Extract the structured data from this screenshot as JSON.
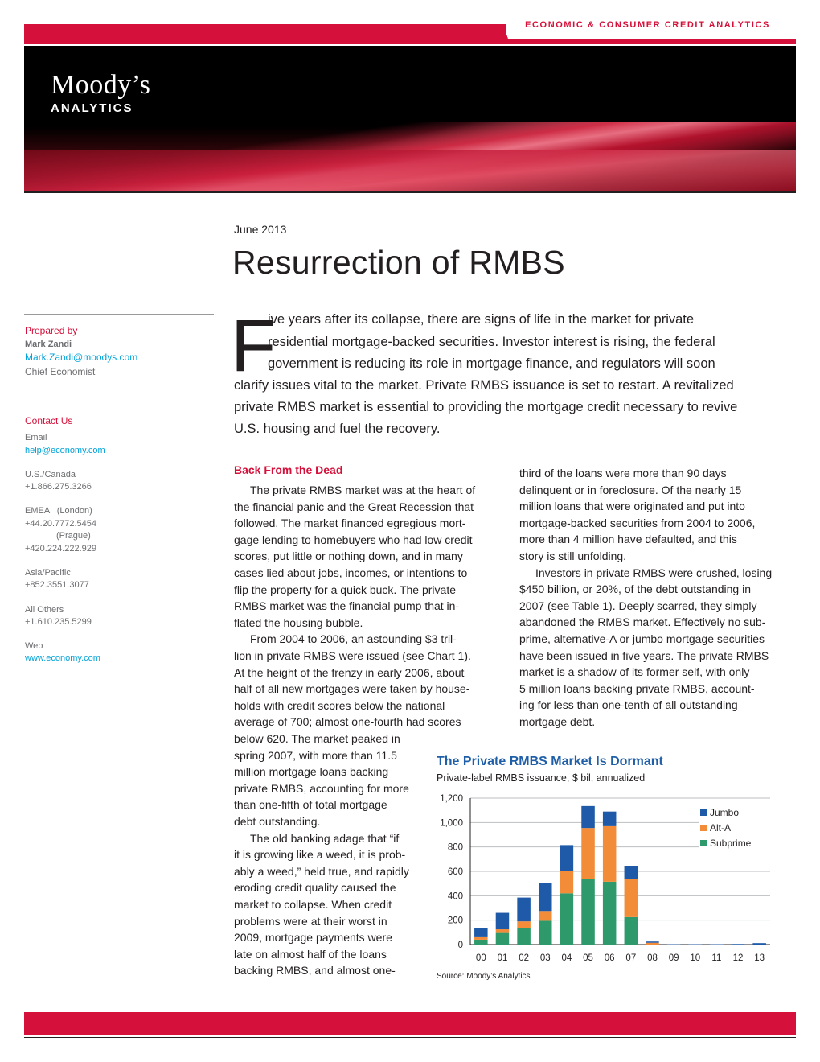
{
  "header": {
    "division": "ECONOMIC & CONSUMER CREDIT ANALYTICS",
    "logo_main": "Moody’s",
    "logo_sub": "ANALYTICS"
  },
  "doc": {
    "date": "June 2013",
    "title": "Resurrection of RMBS"
  },
  "sidebar": {
    "prepared_by_label": "Prepared by",
    "author_name": "Mark Zandi",
    "author_email": "Mark.Zandi@moodys.com",
    "author_role": "Chief Economist",
    "contact_label": "Contact Us",
    "email_label": "Email",
    "email_value": "help@economy.com",
    "contacts": [
      {
        "region": "U.S./Canada",
        "phone": "+1.866.275.3266"
      },
      {
        "region": "EMEA   (London)",
        "phone": "+44.20.7772.5454"
      },
      {
        "region": "(Prague)",
        "phone": "+420.224.222.929"
      },
      {
        "region": "Asia/Pacific",
        "phone": "+852.3551.3077"
      },
      {
        "region": "All Others",
        "phone": "+1.610.235.5299"
      }
    ],
    "web_label": "Web",
    "web_value": "www.economy.com"
  },
  "intro": {
    "dropcap": "F",
    "lines": [
      "ive years after its collapse, there are signs of life in the market for private",
      "residential mortgage-backed securities. Investor interest is rising, the federal",
      "government is reducing its role in mortgage finance, and regulators will soon",
      "clarify issues vital to the market. Private RMBS issuance is set to restart. A revitalized",
      "private RMBS market is essential to providing the mortgage credit necessary to revive",
      "U.S. housing and fuel the recovery."
    ]
  },
  "article": {
    "heading": "Back From the Dead",
    "col1": [
      "The private RMBS market was at the heart of",
      "the financial panic and the Great Recession that",
      "followed. The market financed egregious mort-",
      "gage lending to homebuyers who had low credit",
      "scores, put little or nothing down, and in many",
      "cases lied about jobs, incomes, or intentions to",
      "flip the property for a quick buck. The private",
      "RMBS market was the financial pump that in-",
      "flated the housing bubble.",
      "From 2004 to 2006, an astounding $3 tril-",
      "lion in private RMBS were issued (see Chart 1).",
      "At the height of the frenzy in early 2006, about",
      "half of all new mortgages were taken by house-",
      "holds with credit scores below the national",
      "average of 700; almost one-fourth had scores",
      "below 620. The market peaked in",
      "spring 2007, with more than 11.5",
      "million mortgage loans backing",
      "private RMBS, accounting for more",
      "than one-fifth of total mortgage",
      "debt outstanding.",
      "The old banking adage that “if",
      "it is growing like a weed, it is prob-",
      "ably a weed,” held true, and rapidly",
      "eroding credit quality caused the",
      "market to collapse. When credit",
      "problems were at their worst in",
      "2009, mortgage payments were",
      "late on almost half of the loans",
      "backing RMBS, and almost one-"
    ],
    "col2": [
      "third of the loans were more than 90 days",
      "delinquent or in foreclosure. Of the nearly 15",
      "million loans that were originated and put into",
      "mortgage-backed securities from 2004 to 2006,",
      "more than 4 million have defaulted, and this",
      "story is still unfolding.",
      "Investors in private RMBS were crushed, losing",
      "$450 billion, or 20%, of the debt outstanding in",
      "2007 (see Table 1). Deeply scarred, they simply",
      "abandoned the RMBS market. Effectively no sub-",
      "prime, alternative-A or jumbo mortgage securities",
      "have been issued in five years. The private RMBS",
      "market is a shadow of its former self, with only",
      "5 million loans backing private RMBS, account-",
      "ing for less than one-tenth of all outstanding",
      "mortgage debt."
    ]
  },
  "chart": {
    "title": "The Private RMBS Market Is Dormant",
    "subtitle": "Private-label RMBS issuance, $ bil, annualized",
    "source": "Source: Moody’s Analytics"
  },
  "chart_data": {
    "type": "bar",
    "stacked": true,
    "categories": [
      "00",
      "01",
      "02",
      "03",
      "04",
      "05",
      "06",
      "07",
      "08",
      "09",
      "10",
      "11",
      "12",
      "13"
    ],
    "series": [
      {
        "name": "Subprime",
        "color": "#2e9a6b",
        "values": [
          40,
          95,
          135,
          195,
          420,
          540,
          515,
          225,
          0,
          0,
          0,
          0,
          0,
          0
        ]
      },
      {
        "name": "Alt-A",
        "color": "#f28c38",
        "values": [
          20,
          30,
          55,
          80,
          185,
          415,
          455,
          310,
          15,
          0,
          0,
          0,
          0,
          0
        ]
      },
      {
        "name": "Jumbo",
        "color": "#1f5aa8",
        "values": [
          75,
          135,
          195,
          230,
          210,
          180,
          120,
          110,
          10,
          3,
          3,
          3,
          5,
          12
        ]
      }
    ],
    "ylim": [
      0,
      1200
    ],
    "yticks": [
      "0",
      "200",
      "400",
      "600",
      "800",
      "1,000",
      "1,200"
    ],
    "legend": "top-right",
    "legend_order": [
      "Jumbo",
      "Alt-A",
      "Subprime"
    ],
    "grid": true
  }
}
